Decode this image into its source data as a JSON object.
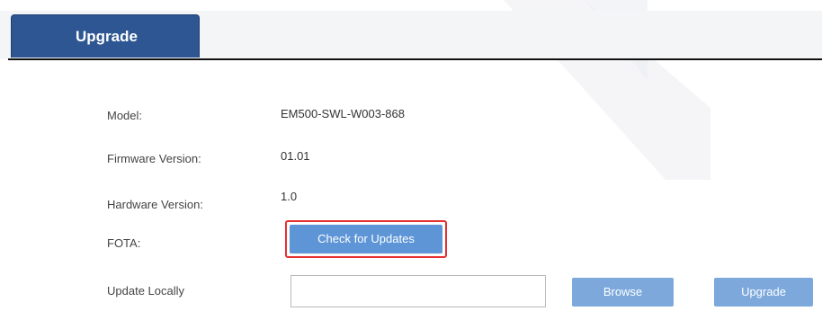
{
  "tabs": [
    {
      "label": "Upgrade",
      "active": true
    }
  ],
  "rows": {
    "model": {
      "label": "Model:",
      "value": "EM500-SWL-W003-868"
    },
    "firmware": {
      "label": "Firmware Version:",
      "value": "01.01"
    },
    "hardware": {
      "label": "Hardware Version:",
      "value": "1.0"
    },
    "fota": {
      "label": "FOTA:",
      "button": "Check for Updates"
    },
    "local": {
      "label": "Update Locally",
      "file_value": "",
      "browse": "Browse",
      "upgrade": "Upgrade"
    }
  },
  "colors": {
    "tab_active": "#2d5693",
    "button_primary": "#5d95d6",
    "button_secondary": "#7ca8dc",
    "highlight": "#e53030"
  }
}
